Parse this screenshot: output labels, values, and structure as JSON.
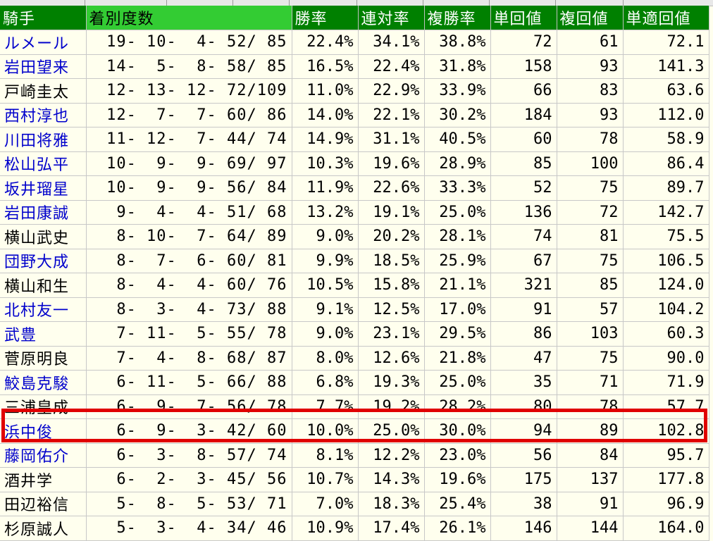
{
  "header": {
    "jockey": "騎手",
    "record": "着別度数",
    "win_rate": "勝率",
    "place_rate": "連対率",
    "show_rate": "複勝率",
    "win_return": "単回値",
    "show_return": "複回値",
    "fit_return": "単適回値"
  },
  "colors": {
    "header_bg": "#008000",
    "header_highlight": "#33cc33",
    "row_bg": "#ffffee",
    "link_name": "#0000cc",
    "win_rate": "#990000",
    "place_rate": "#0000cc",
    "win_return": "#006600",
    "highlight_border": "#e00000"
  },
  "rows": [
    {
      "name": "ルメール",
      "link": true,
      "record": "19- 10-  4- 52/ 85",
      "win": "22.4%",
      "ren": "34.1%",
      "fuk": "38.8%",
      "tan": "72",
      "fkv": "61",
      "tek": "72.1"
    },
    {
      "name": "岩田望来",
      "link": true,
      "record": "14-  5-  8- 58/ 85",
      "win": "16.5%",
      "ren": "22.4%",
      "fuk": "31.8%",
      "tan": "158",
      "fkv": "93",
      "tek": "141.3"
    },
    {
      "name": "戸崎圭太",
      "link": false,
      "record": "12- 13- 12- 72/109",
      "win": "11.0%",
      "ren": "22.9%",
      "fuk": "33.9%",
      "tan": "66",
      "fkv": "83",
      "tek": "63.6"
    },
    {
      "name": "西村淳也",
      "link": true,
      "record": "12-  7-  7- 60/ 86",
      "win": "14.0%",
      "ren": "22.1%",
      "fuk": "30.2%",
      "tan": "184",
      "fkv": "93",
      "tek": "112.0"
    },
    {
      "name": "川田将雅",
      "link": true,
      "record": "11- 12-  7- 44/ 74",
      "win": "14.9%",
      "ren": "31.1%",
      "fuk": "40.5%",
      "tan": "60",
      "fkv": "78",
      "tek": "58.9"
    },
    {
      "name": "松山弘平",
      "link": true,
      "record": "10-  9-  9- 69/ 97",
      "win": "10.3%",
      "ren": "19.6%",
      "fuk": "28.9%",
      "tan": "85",
      "fkv": "100",
      "tek": "86.4"
    },
    {
      "name": "坂井瑠星",
      "link": true,
      "record": "10-  9-  9- 56/ 84",
      "win": "11.9%",
      "ren": "22.6%",
      "fuk": "33.3%",
      "tan": "52",
      "fkv": "75",
      "tek": "89.7"
    },
    {
      "name": "岩田康誠",
      "link": true,
      "record": " 9-  4-  4- 51/ 68",
      "win": "13.2%",
      "ren": "19.1%",
      "fuk": "25.0%",
      "tan": "136",
      "fkv": "72",
      "tek": "142.7"
    },
    {
      "name": "横山武史",
      "link": false,
      "record": " 8- 10-  7- 64/ 89",
      "win": "9.0%",
      "ren": "20.2%",
      "fuk": "28.1%",
      "tan": "74",
      "fkv": "81",
      "tek": "75.5"
    },
    {
      "name": "団野大成",
      "link": true,
      "record": " 8-  7-  6- 60/ 81",
      "win": "9.9%",
      "ren": "18.5%",
      "fuk": "25.9%",
      "tan": "67",
      "fkv": "75",
      "tek": "106.5"
    },
    {
      "name": "横山和生",
      "link": false,
      "record": " 8-  4-  4- 60/ 76",
      "win": "10.5%",
      "ren": "15.8%",
      "fuk": "21.1%",
      "tan": "321",
      "fkv": "85",
      "tek": "124.0"
    },
    {
      "name": "北村友一",
      "link": true,
      "record": " 8-  3-  4- 73/ 88",
      "win": "9.1%",
      "ren": "12.5%",
      "fuk": "17.0%",
      "tan": "91",
      "fkv": "57",
      "tek": "104.2"
    },
    {
      "name": "武豊",
      "link": true,
      "record": " 7- 11-  5- 55/ 78",
      "win": "9.0%",
      "ren": "23.1%",
      "fuk": "29.5%",
      "tan": "86",
      "fkv": "103",
      "tek": "60.3"
    },
    {
      "name": "菅原明良",
      "link": false,
      "record": " 7-  4-  8- 68/ 87",
      "win": "8.0%",
      "ren": "12.6%",
      "fuk": "21.8%",
      "tan": "47",
      "fkv": "75",
      "tek": "90.0"
    },
    {
      "name": "鮫島克駿",
      "link": true,
      "record": " 6- 11-  5- 66/ 88",
      "win": "6.8%",
      "ren": "19.3%",
      "fuk": "25.0%",
      "tan": "35",
      "fkv": "71",
      "tek": "71.9"
    },
    {
      "name": "三浦皇成",
      "link": false,
      "record": " 6-  9-  7- 56/ 78",
      "win": "7.7%",
      "ren": "19.2%",
      "fuk": "28.2%",
      "tan": "80",
      "fkv": "78",
      "tek": "57.7"
    },
    {
      "name": "浜中俊",
      "link": true,
      "record": " 6-  9-  3- 42/ 60",
      "win": "10.0%",
      "ren": "25.0%",
      "fuk": "30.0%",
      "tan": "94",
      "fkv": "89",
      "tek": "102.8"
    },
    {
      "name": "藤岡佑介",
      "link": true,
      "record": " 6-  3-  8- 57/ 74",
      "win": "8.1%",
      "ren": "12.2%",
      "fuk": "23.0%",
      "tan": "56",
      "fkv": "84",
      "tek": "95.7"
    },
    {
      "name": "酒井学",
      "link": false,
      "record": " 6-  2-  3- 45/ 56",
      "win": "10.7%",
      "ren": "14.3%",
      "fuk": "19.6%",
      "tan": "175",
      "fkv": "137",
      "tek": "177.8"
    },
    {
      "name": "田辺裕信",
      "link": false,
      "record": " 5-  8-  5- 53/ 71",
      "win": "7.0%",
      "ren": "18.3%",
      "fuk": "25.4%",
      "tan": "38",
      "fkv": "91",
      "tek": "96.9"
    },
    {
      "name": "杉原誠人",
      "link": false,
      "record": " 5-  3-  4- 34/ 46",
      "win": "10.9%",
      "ren": "17.4%",
      "fuk": "26.1%",
      "tan": "146",
      "fkv": "144",
      "tek": "164.0"
    }
  ]
}
